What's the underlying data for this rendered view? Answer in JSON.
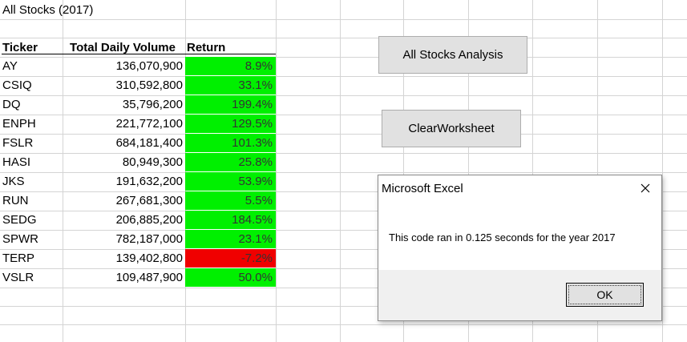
{
  "sheet": {
    "title": "All Stocks (2017)",
    "headers": {
      "ticker": "Ticker",
      "volume": "Total Daily Volume",
      "return": "Return"
    },
    "rows": [
      {
        "ticker": "AY",
        "volume": "136,070,900",
        "return": "8.9%",
        "status": "positive"
      },
      {
        "ticker": "CSIQ",
        "volume": "310,592,800",
        "return": "33.1%",
        "status": "positive"
      },
      {
        "ticker": "DQ",
        "volume": "35,796,200",
        "return": "199.4%",
        "status": "positive"
      },
      {
        "ticker": "ENPH",
        "volume": "221,772,100",
        "return": "129.5%",
        "status": "positive"
      },
      {
        "ticker": "FSLR",
        "volume": "684,181,400",
        "return": "101.3%",
        "status": "positive"
      },
      {
        "ticker": "HASI",
        "volume": "80,949,300",
        "return": "25.8%",
        "status": "positive"
      },
      {
        "ticker": "JKS",
        "volume": "191,632,200",
        "return": "53.9%",
        "status": "positive"
      },
      {
        "ticker": "RUN",
        "volume": "267,681,300",
        "return": "5.5%",
        "status": "positive"
      },
      {
        "ticker": "SEDG",
        "volume": "206,885,200",
        "return": "184.5%",
        "status": "positive"
      },
      {
        "ticker": "SPWR",
        "volume": "782,187,000",
        "return": "23.1%",
        "status": "positive"
      },
      {
        "ticker": "TERP",
        "volume": "139,402,800",
        "return": "-7.2%",
        "status": "negative"
      },
      {
        "ticker": "VSLR",
        "volume": "109,487,900",
        "return": "50.0%",
        "status": "positive"
      }
    ]
  },
  "buttons": {
    "analysis_label": "All Stocks Analysis",
    "clear_label": "ClearWorksheet"
  },
  "dialog": {
    "title": "Microsoft Excel",
    "message": "This code ran in 0.125 seconds for the year 2017",
    "ok_label": "OK",
    "close_icon": "close-icon"
  },
  "colors": {
    "positive": "#00f000",
    "negative": "#f00000",
    "gridline": "#d4d4d4"
  }
}
